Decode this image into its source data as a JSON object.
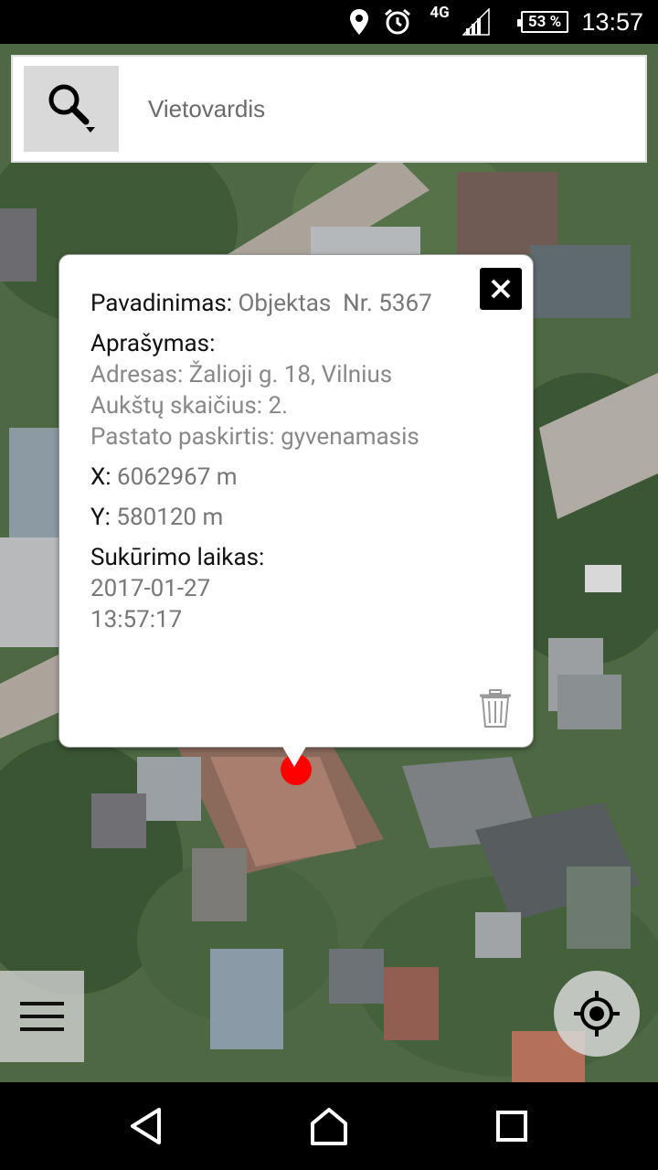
{
  "status_bar": {
    "network": "4G",
    "battery": "53 %",
    "time": "13:57",
    "icons": [
      "location-icon",
      "alarm-icon",
      "signal-icon",
      "battery-icon"
    ]
  },
  "search": {
    "placeholder": "Vietovardis",
    "value": ""
  },
  "popup": {
    "name_label": "Pavadinimas: ",
    "name_value": "Objektas  Nr. 5367",
    "desc_label": "Aprašymas:",
    "desc_lines": [
      "Adresas: Žalioji g. 18, Vilnius",
      "Aukštų skaičius: 2.",
      "Pastato paskirtis: gyvenamasis"
    ],
    "x_label": "X: ",
    "x_value": "6062967 m",
    "y_label": "Y: ",
    "y_value": "580120 m",
    "created_label": "Sukūrimo laikas:",
    "created_date": "2017-01-27",
    "created_time": "13:57:17"
  },
  "colors": {
    "marker": "#ff0000",
    "label_text": "#111111",
    "value_text": "#777777"
  }
}
